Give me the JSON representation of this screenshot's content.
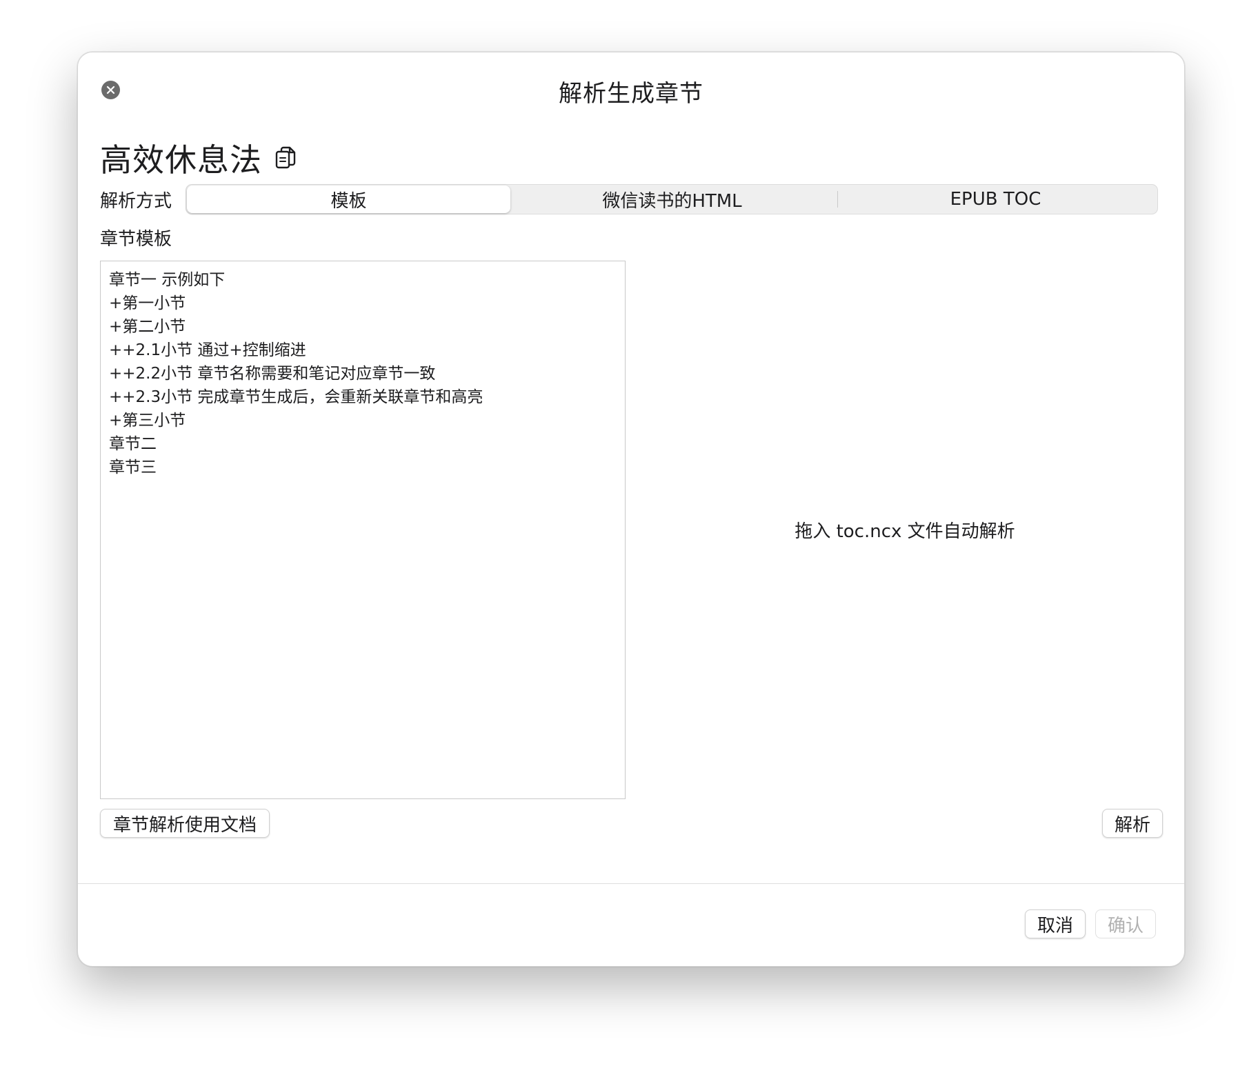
{
  "window": {
    "title": "解析生成章节"
  },
  "book": {
    "title": "高效休息法"
  },
  "method": {
    "label": "解析方式",
    "options": [
      "模板",
      "微信读书的HTML",
      "EPUB TOC"
    ],
    "selected": "模板"
  },
  "template": {
    "label": "章节模板",
    "content": "章节一 示例如下\n+第一小节\n+第二小节\n++2.1小节 通过+控制缩进\n++2.2小节 章节名称需要和笔记对应章节一致\n++2.3小节 完成章节生成后，会重新关联章节和高亮\n+第三小节\n章节二\n章节三"
  },
  "drop_zone": {
    "text": "拖入 toc.ncx 文件自动解析"
  },
  "buttons": {
    "docs": "章节解析使用文档",
    "parse": "解析",
    "cancel": "取消",
    "confirm": "确认"
  },
  "icons": {
    "close": "close-icon",
    "copy": "copy-icon"
  }
}
